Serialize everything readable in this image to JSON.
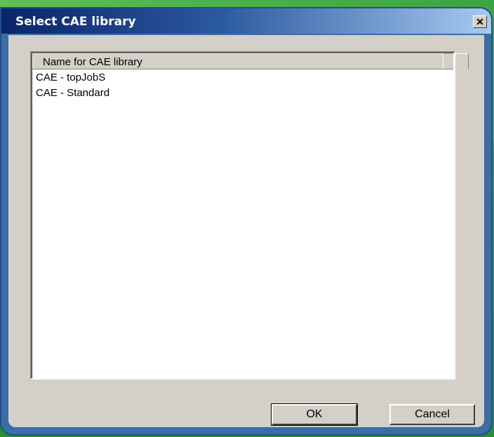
{
  "window": {
    "title": "Select CAE library",
    "close_glyph": "✕"
  },
  "listview": {
    "column_header": "Name for CAE library",
    "items": [
      "CAE - topJobS",
      "CAE - Standard"
    ]
  },
  "buttons": {
    "ok_label": "OK",
    "cancel_label": "Cancel"
  },
  "colors": {
    "titlebar_start": "#0a246a",
    "titlebar_end": "#a6caf0",
    "dialog_face": "#d4d0c8",
    "window_frame": "#3a6ea5",
    "desktop_green": "#3aa63d"
  }
}
